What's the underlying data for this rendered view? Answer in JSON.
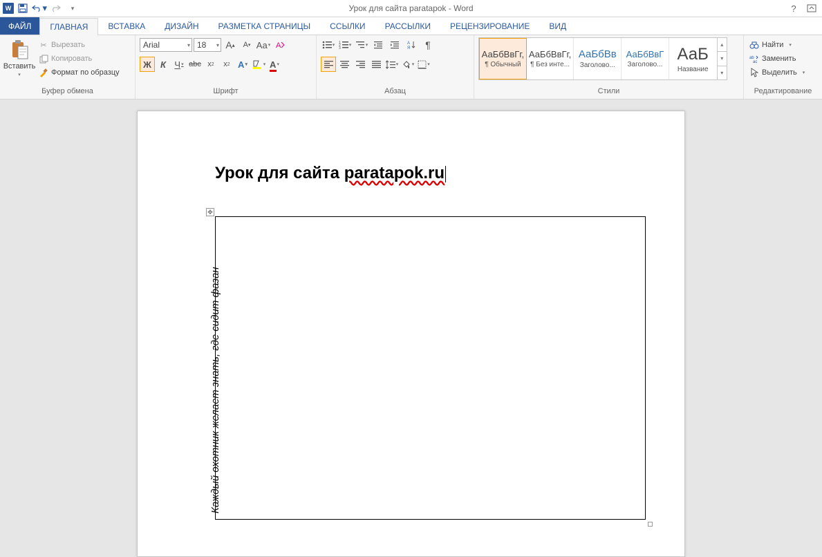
{
  "title": "Урок для сайта paratapok - Word",
  "qat": {
    "save": "save",
    "undo": "undo",
    "redo": "redo"
  },
  "tabs": {
    "file": "ФАЙЛ",
    "home": "ГЛАВНАЯ",
    "insert": "ВСТАВКА",
    "design": "ДИЗАЙН",
    "layout": "РАЗМЕТКА СТРАНИЦЫ",
    "references": "ССЫЛКИ",
    "mailings": "РАССЫЛКИ",
    "review": "РЕЦЕНЗИРОВАНИЕ",
    "view": "ВИД"
  },
  "clipboard": {
    "paste": "Вставить",
    "cut": "Вырезать",
    "copy": "Копировать",
    "format_painter": "Формат по образцу",
    "group": "Буфер обмена"
  },
  "font": {
    "name": "Arial",
    "size": "18",
    "group": "Шрифт"
  },
  "paragraph": {
    "group": "Абзац"
  },
  "styles": {
    "group": "Стили",
    "items": [
      {
        "sample": "АаБбВвГг,",
        "name": "¶ Обычный",
        "color": "#000",
        "selected": true
      },
      {
        "sample": "АаБбВвГг,",
        "name": "¶ Без инте...",
        "color": "#000"
      },
      {
        "sample": "АаБбВв",
        "name": "Заголово...",
        "color": "#2e74b5"
      },
      {
        "sample": "АаБбВвГ",
        "name": "Заголово...",
        "color": "#2e74b5"
      },
      {
        "sample": "АаБ",
        "name": "Название",
        "color": "#000",
        "big": true
      }
    ]
  },
  "editing": {
    "find": "Найти",
    "replace": "Заменить",
    "select": "Выделить",
    "group": "Редактирование"
  },
  "document": {
    "heading_prefix": "Урок для сайта ",
    "heading_link": "paratapok.ru",
    "cell_text": "Каждый охотник желает знать, где сидит фазан"
  }
}
